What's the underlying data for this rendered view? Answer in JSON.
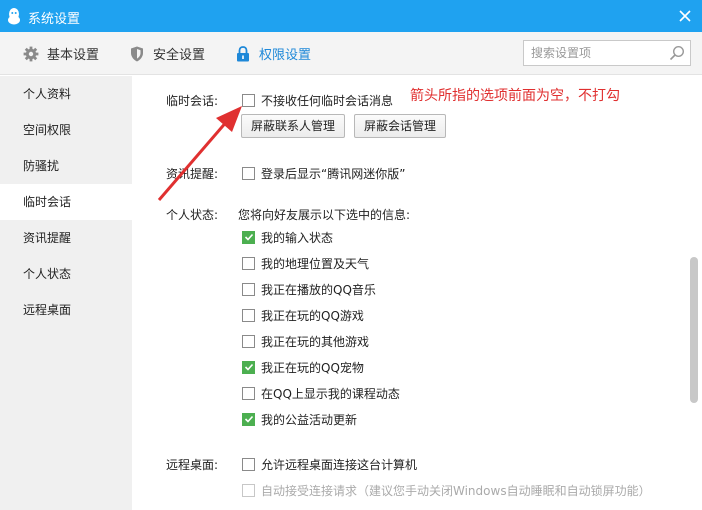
{
  "window": {
    "title": "系统设置"
  },
  "toolbar": {
    "tabs": [
      {
        "label": "基本设置",
        "icon": "gear-icon"
      },
      {
        "label": "安全设置",
        "icon": "shield-icon"
      },
      {
        "label": "权限设置",
        "icon": "lock-icon",
        "active": true
      }
    ],
    "search_placeholder": "搜索设置项"
  },
  "sidebar": {
    "items": [
      {
        "label": "个人资料"
      },
      {
        "label": "空间权限"
      },
      {
        "label": "防骚扰"
      },
      {
        "label": "临时会话",
        "active": true
      },
      {
        "label": "资讯提醒"
      },
      {
        "label": "个人状态"
      },
      {
        "label": "远程桌面"
      }
    ]
  },
  "temp_chat": {
    "label": "临时会话:",
    "option": {
      "label": "不接收任何临时会话消息",
      "checked": false
    },
    "btn_contacts": "屏蔽联系人管理",
    "btn_sessions": "屏蔽会话管理",
    "annotation": "箭头所指的选项前面为空，不打勾"
  },
  "news": {
    "label": "资讯提醒:",
    "option": {
      "label": "登录后显示“腾讯网迷你版”",
      "checked": false
    }
  },
  "status": {
    "label": "个人状态:",
    "desc": "您将向好友展示以下选中的信息:",
    "items": [
      {
        "label": "我的输入状态",
        "checked": true
      },
      {
        "label": "我的地理位置及天气",
        "checked": false
      },
      {
        "label": "我正在播放的QQ音乐",
        "checked": false
      },
      {
        "label": "我正在玩的QQ游戏",
        "checked": false
      },
      {
        "label": "我正在玩的其他游戏",
        "checked": false
      },
      {
        "label": "我正在玩的QQ宠物",
        "checked": true
      },
      {
        "label": "在QQ上显示我的课程动态",
        "checked": false
      },
      {
        "label": "我的公益活动更新",
        "checked": true
      }
    ]
  },
  "remote": {
    "label": "远程桌面:",
    "option1": {
      "label": "允许远程桌面连接这台计算机",
      "checked": false
    },
    "option2": {
      "label": "自动接受连接请求（建议您手动关闭Windows自动睡眠和自动锁屏功能）",
      "checked": false,
      "disabled": true
    }
  },
  "colors": {
    "titlebar": "#1fa2f0",
    "accent": "#1e88d8",
    "check": "#4caf50",
    "annotation": "#e03030"
  }
}
